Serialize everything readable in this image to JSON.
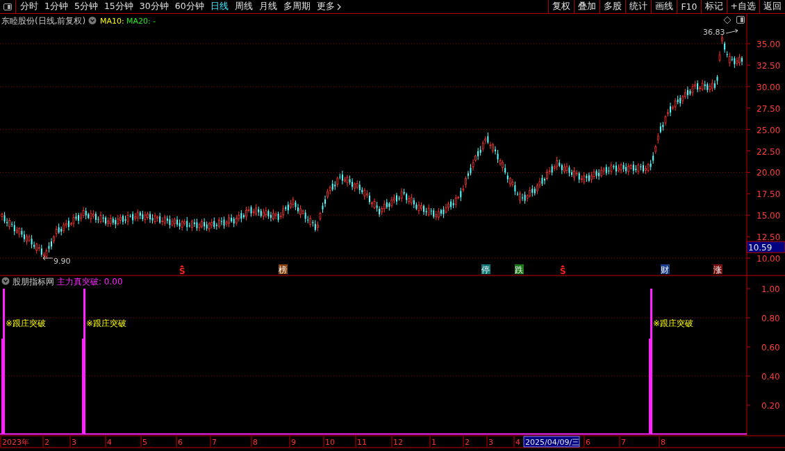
{
  "toolbar": {
    "periods": [
      {
        "label": "分时",
        "selected": false
      },
      {
        "label": "1分钟",
        "selected": false
      },
      {
        "label": "5分钟",
        "selected": false
      },
      {
        "label": "15分钟",
        "selected": false
      },
      {
        "label": "30分钟",
        "selected": false
      },
      {
        "label": "60分钟",
        "selected": false
      },
      {
        "label": "日线",
        "selected": true
      },
      {
        "label": "周线",
        "selected": false
      },
      {
        "label": "月线",
        "selected": false
      },
      {
        "label": "多周期",
        "selected": false
      },
      {
        "label": "更多",
        "selected": false
      }
    ],
    "buttons": [
      "复权",
      "叠加",
      "多股",
      "统计",
      "画线",
      "F10",
      "标记",
      "+自选",
      "返回"
    ]
  },
  "price_panel": {
    "title": "东睦股份(日线,前复权)",
    "ma10": "MA10:",
    "ma20": "MA20: -",
    "y_labels": [
      "35.00",
      "32.50",
      "30.00",
      "27.50",
      "25.00",
      "22.50",
      "20.00",
      "17.50",
      "15.00",
      "12.50",
      "10.00"
    ],
    "last_price": "10.59",
    "high_label": "36.83",
    "low_label": "9.90",
    "events": [
      {
        "label": "S",
        "kind": "signal",
        "color": "#ff2020"
      },
      {
        "label": "榜",
        "kind": "badge",
        "color": "#8b4513"
      },
      {
        "label": "停",
        "kind": "badge",
        "color": "#127a7a"
      },
      {
        "label": "跌",
        "kind": "badge",
        "color": "#1a7a1a"
      },
      {
        "label": "S",
        "kind": "signal",
        "color": "#ff2020"
      },
      {
        "label": "财",
        "kind": "badge",
        "color": "#1a3f8a"
      },
      {
        "label": "涨",
        "kind": "badge",
        "color": "#7a1010"
      }
    ]
  },
  "indicator_panel": {
    "source": "股朋指标网",
    "name": "主力真突破: 0.00",
    "y_labels": [
      "1.00",
      "0.80",
      "0.60",
      "0.40",
      "0.20"
    ],
    "signals": [
      "※跟庄突破",
      "※跟庄突破",
      "※跟庄突破"
    ]
  },
  "date_axis": [
    {
      "label": "2023年",
      "selected": false
    },
    {
      "label": "2",
      "selected": false
    },
    {
      "label": "3",
      "selected": false
    },
    {
      "label": "4",
      "selected": false
    },
    {
      "label": "5",
      "selected": false
    },
    {
      "label": "6",
      "selected": false
    },
    {
      "label": "7",
      "selected": false
    },
    {
      "label": "8",
      "selected": false
    },
    {
      "label": "9",
      "selected": false
    },
    {
      "label": "10",
      "selected": false
    },
    {
      "label": "11",
      "selected": false
    },
    {
      "label": "12",
      "selected": false
    },
    {
      "label": "1",
      "selected": false
    },
    {
      "label": "2",
      "selected": false
    },
    {
      "label": "3",
      "selected": false
    },
    {
      "label": "4",
      "selected": false
    },
    {
      "label": "2025/04/09/三",
      "selected": true
    },
    {
      "label": "6",
      "selected": false
    },
    {
      "label": "7",
      "selected": false
    },
    {
      "label": "8",
      "selected": false
    }
  ]
}
